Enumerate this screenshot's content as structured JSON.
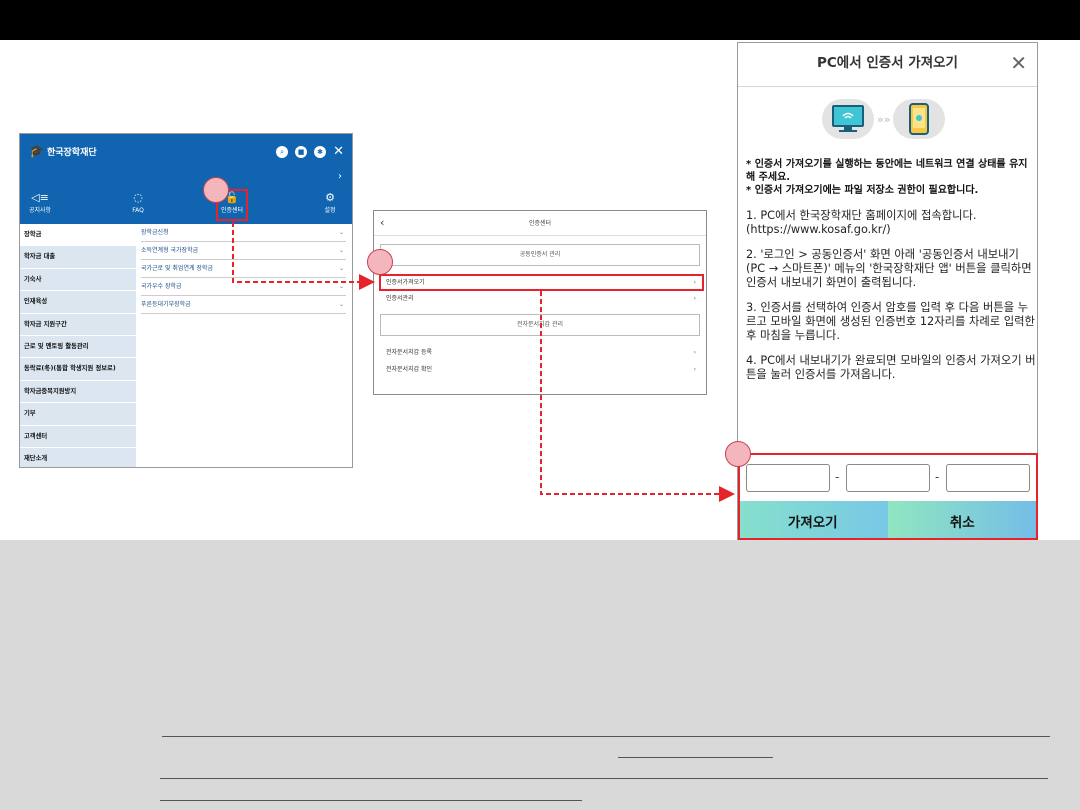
{
  "app_screen": {
    "logo_text": "한국장학재단",
    "nav": [
      {
        "icon": "speaker-icon",
        "label": "공지사항"
      },
      {
        "icon": "chat-icon",
        "label": "FAQ"
      },
      {
        "icon": "lock-icon",
        "label": "인증센터"
      },
      {
        "icon": "gear-icon",
        "label": "설정"
      }
    ],
    "sidebar": [
      "장학금",
      "학자금 대출",
      "기숙사",
      "인재육성",
      "학자금 지원구간",
      "근로 및 멘토링 활동관리",
      "동락료(冬)(통합 학생지원 정보로)",
      "학자금중복지원방지",
      "기부",
      "고객센터",
      "재단소개"
    ],
    "submenu": [
      "장학금신청",
      "소득연계형 국가장학금",
      "국가근로 및 취업연계 장학금",
      "국가우수 장학금",
      "푸른등대기부장학금"
    ]
  },
  "cert_screen": {
    "title": "인증센터",
    "section1": "공동인증서 관리",
    "items1": [
      "인증서가져오기",
      "인증서관리"
    ],
    "section2": "전자문서지갑 관리",
    "items2": [
      "전자문서지갑 등록",
      "전자문서지갑 확인"
    ]
  },
  "dialog": {
    "title": "PC에서 인증서 가져오기",
    "notes": [
      "* 인증서 가져오기를 실행하는 동안에는 네트워크 연결 상태를 유지해 주세요.",
      "* 인증서 가져오기에는 파일 저장소 권한이 필요합니다."
    ],
    "steps": [
      "1. PC에서 한국장학재단 홈페이지에 접속합니다. (https://www.kosaf.go.kr/)",
      "2. '로그인 > 공동인증서' 화면 아래 '공동인증서 내보내기(PC → 스마트폰)' 메뉴의 '한국장학재단 앱' 버튼을 클릭하면 인증서 내보내기 화면이 출력됩니다.",
      "3. 인증서를 선택하여 인증서 암호를 입력 후 다음 버튼을 누르고 모바일 화면에 생성된 인증번호 12자리를 차례로 입력한 후 마침을 누릅니다.",
      "4. PC에서 내보내기가 완료되면 모바일의 인증서 가져오기 버튼을 눌러 인증서를 가져옵니다."
    ],
    "separator": "-",
    "import_button": "가져오기",
    "cancel_button": "취소"
  },
  "colors": {
    "app_blue": "#1064b0",
    "highlight_red": "#e6232a",
    "callout_pink": "#f3b6bc"
  }
}
